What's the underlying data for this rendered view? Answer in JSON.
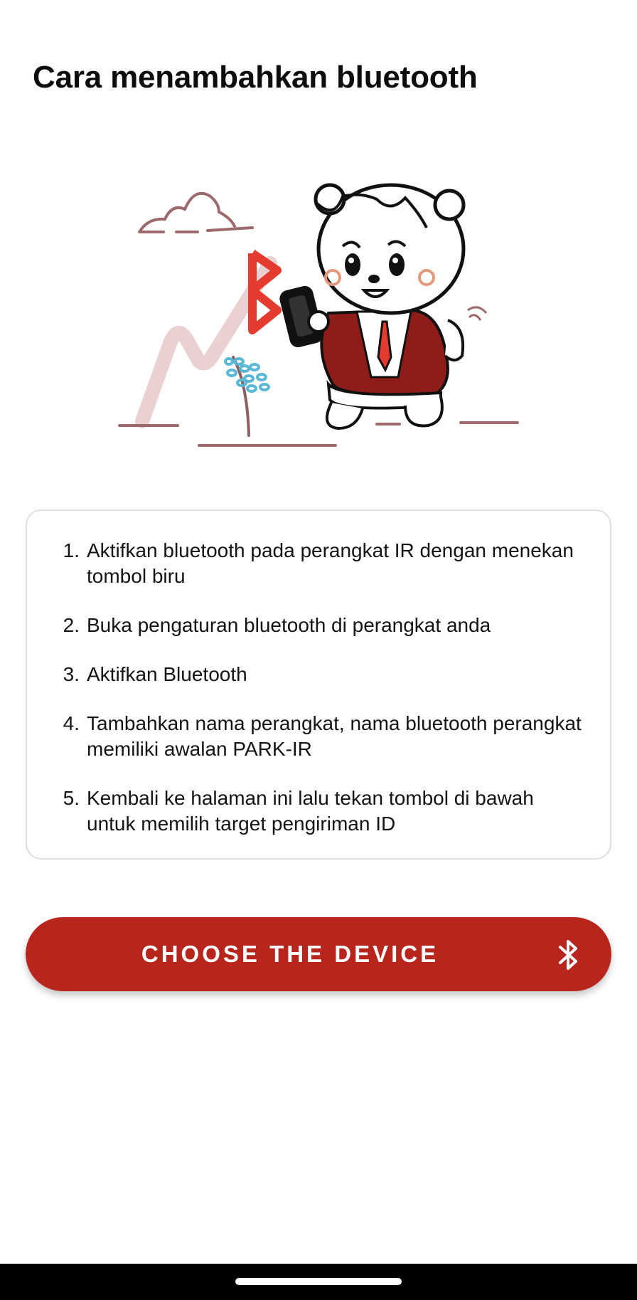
{
  "header": {
    "title": "Cara menambahkan bluetooth"
  },
  "instructions": {
    "steps": [
      {
        "number": "1.",
        "text": "Aktifkan bluetooth pada perangkat IR dengan menekan tombol biru"
      },
      {
        "number": "2.",
        "text": "Buka pengaturan bluetooth di perangkat anda"
      },
      {
        "number": "3.",
        "text": "Aktifkan Bluetooth"
      },
      {
        "number": "4.",
        "text": "Tambahkan nama perangkat, nama bluetooth perangkat memiliki awalan PARK-IR"
      },
      {
        "number": "5.",
        "text": "Kembali ke halaman ini lalu tekan tombol di bawah untuk memilih target pengiriman ID"
      }
    ]
  },
  "action": {
    "label": "CHOOSE THE DEVICE",
    "icon": "bluetooth-icon",
    "color": "#b8251d"
  },
  "colors": {
    "accent": "#b8251d",
    "illustration_red": "#e53a2e",
    "illustration_pink": "#e8c9c9",
    "illustration_blue": "#5ab8d6",
    "illustration_brown": "#9c6a6a"
  }
}
